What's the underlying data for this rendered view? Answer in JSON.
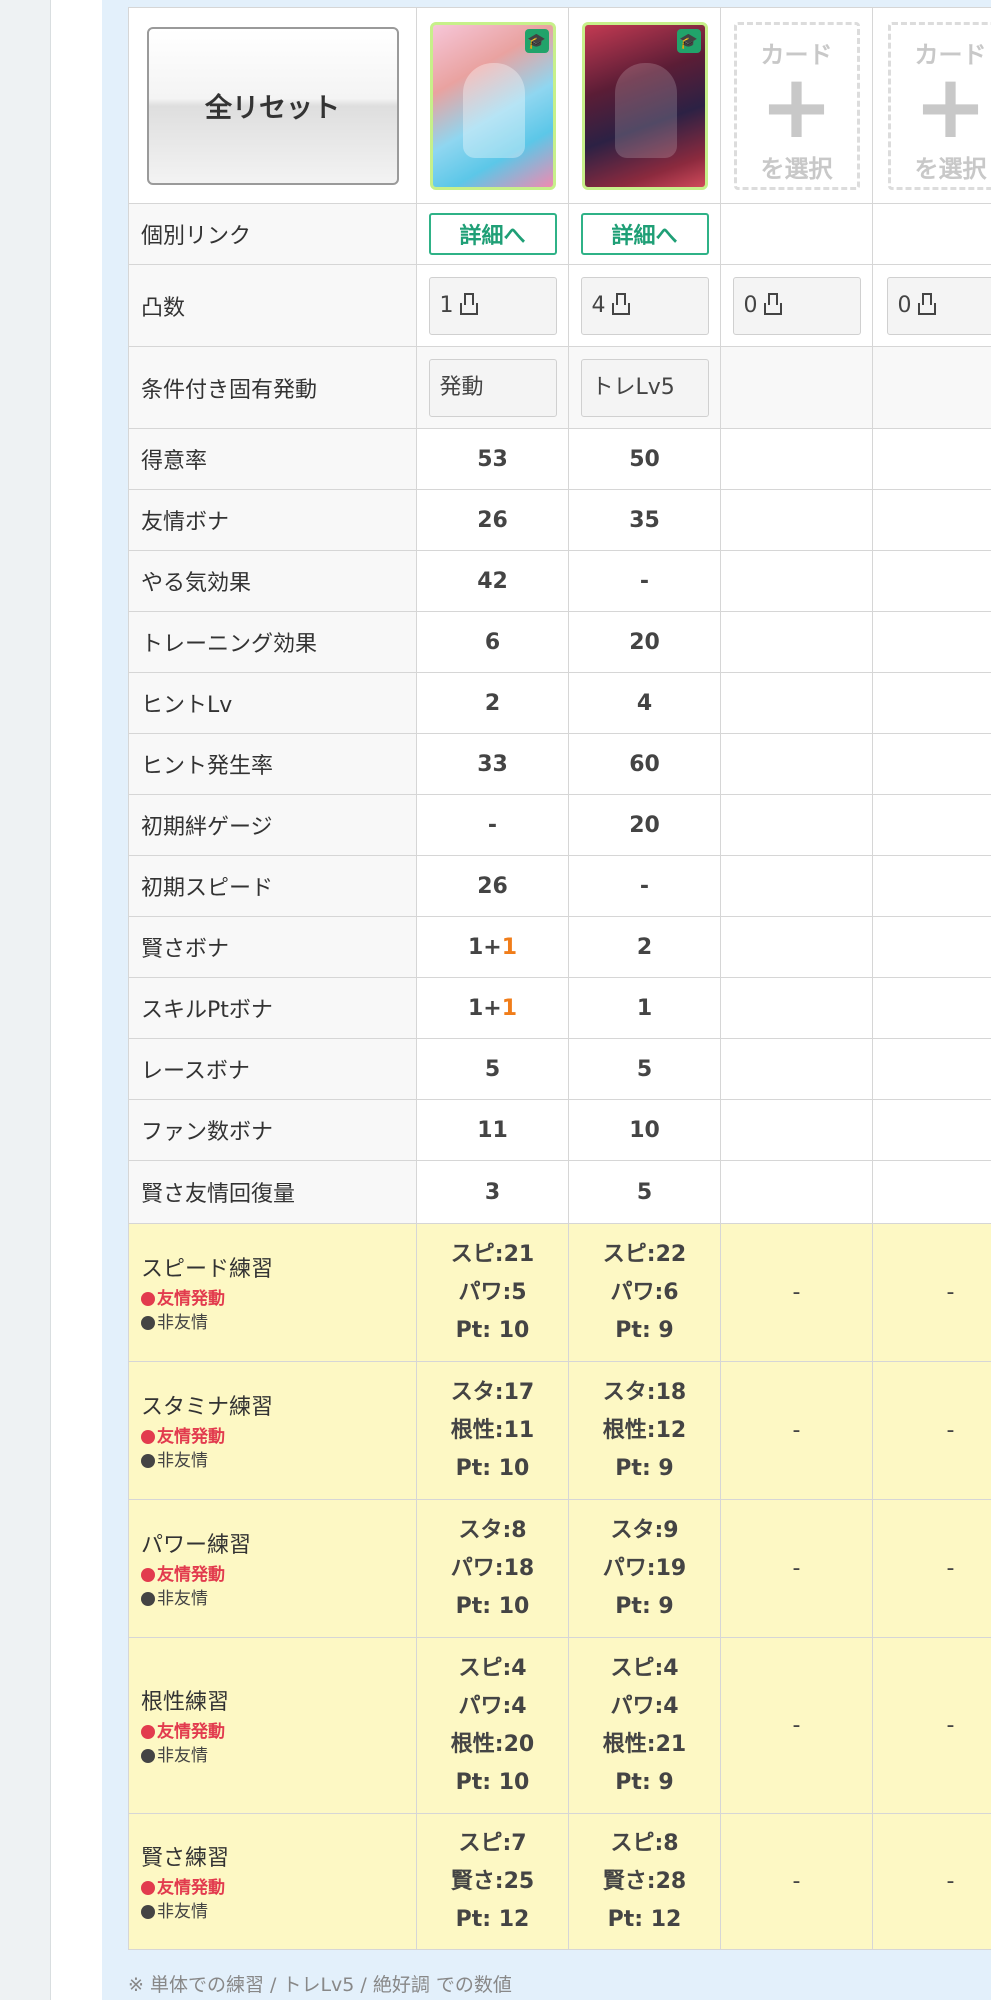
{
  "reset_button": "全リセット",
  "cards": [
    {
      "filled": true,
      "detail_label": "詳細へ",
      "limit_break": "1",
      "condition": "発動"
    },
    {
      "filled": true,
      "detail_label": "詳細へ",
      "limit_break": "4",
      "condition": "トレLv5"
    },
    {
      "filled": false,
      "slot_top": "カード",
      "slot_bottom": "を選択",
      "limit_break": "0"
    },
    {
      "filled": false,
      "slot_top": "カード",
      "slot_bottom": "を選択",
      "limit_break": "0"
    }
  ],
  "labels": {
    "link": "個別リンク",
    "limit_break": "凸数",
    "condition": "条件付き固有発動"
  },
  "stats": [
    {
      "label": "得意率",
      "values": [
        "53",
        "50"
      ]
    },
    {
      "label": "友情ボナ",
      "values": [
        "26",
        "35"
      ]
    },
    {
      "label": "やる気効果",
      "values": [
        "42",
        "-"
      ]
    },
    {
      "label": "トレーニング効果",
      "values": [
        "6",
        "20"
      ]
    },
    {
      "label": "ヒントLv",
      "values": [
        "2",
        "4"
      ]
    },
    {
      "label": "ヒント発生率",
      "values": [
        "33",
        "60"
      ]
    },
    {
      "label": "初期絆ゲージ",
      "values": [
        "-",
        "20"
      ]
    },
    {
      "label": "初期スピード",
      "values": [
        "26",
        "-"
      ]
    },
    {
      "label": "賢さボナ",
      "values": [
        "1+",
        "2"
      ],
      "extra": [
        "1",
        ""
      ]
    },
    {
      "label": "スキルPtボナ",
      "values": [
        "1+",
        "1"
      ],
      "extra": [
        "1",
        ""
      ]
    },
    {
      "label": "レースボナ",
      "values": [
        "5",
        "5"
      ]
    },
    {
      "label": "ファン数ボナ",
      "values": [
        "11",
        "10"
      ]
    },
    {
      "label": "賢さ友情回復量",
      "values": [
        "3",
        "5"
      ]
    }
  ],
  "training_legend": {
    "friendship": "友情発動",
    "non_friendship": "非友情"
  },
  "trainings": [
    {
      "label": "スピード練習",
      "card1": [
        "スピ:21",
        "パワ:5",
        "Pt: 10"
      ],
      "card2": [
        "スピ:22",
        "パワ:6",
        "Pt: 9"
      ],
      "empty": "-"
    },
    {
      "label": "スタミナ練習",
      "card1": [
        "スタ:17",
        "根性:11",
        "Pt: 10"
      ],
      "card2": [
        "スタ:18",
        "根性:12",
        "Pt: 9"
      ],
      "empty": "-"
    },
    {
      "label": "パワー練習",
      "card1": [
        "スタ:8",
        "パワ:18",
        "Pt: 10"
      ],
      "card2": [
        "スタ:9",
        "パワ:19",
        "Pt: 9"
      ],
      "empty": "-"
    },
    {
      "label": "根性練習",
      "card1": [
        "スピ:4",
        "パワ:4",
        "根性:20",
        "Pt: 10"
      ],
      "card2": [
        "スピ:4",
        "パワ:4",
        "根性:21",
        "Pt: 9"
      ],
      "empty": "-"
    },
    {
      "label": "賢さ練習",
      "card1": [
        "スピ:7",
        "賢さ:25",
        "Pt: 12"
      ],
      "card2": [
        "スピ:8",
        "賢さ:28",
        "Pt: 12"
      ],
      "empty": "-"
    }
  ],
  "footnote": "※ 単体での練習 / トレLv5 / 絶好調 での数値",
  "colors": {
    "highlight_orange": "#f07d1a",
    "friendship_red": "#e23b4e",
    "training_bg": "#fdf8c4",
    "detail_green": "#1f9f76"
  }
}
